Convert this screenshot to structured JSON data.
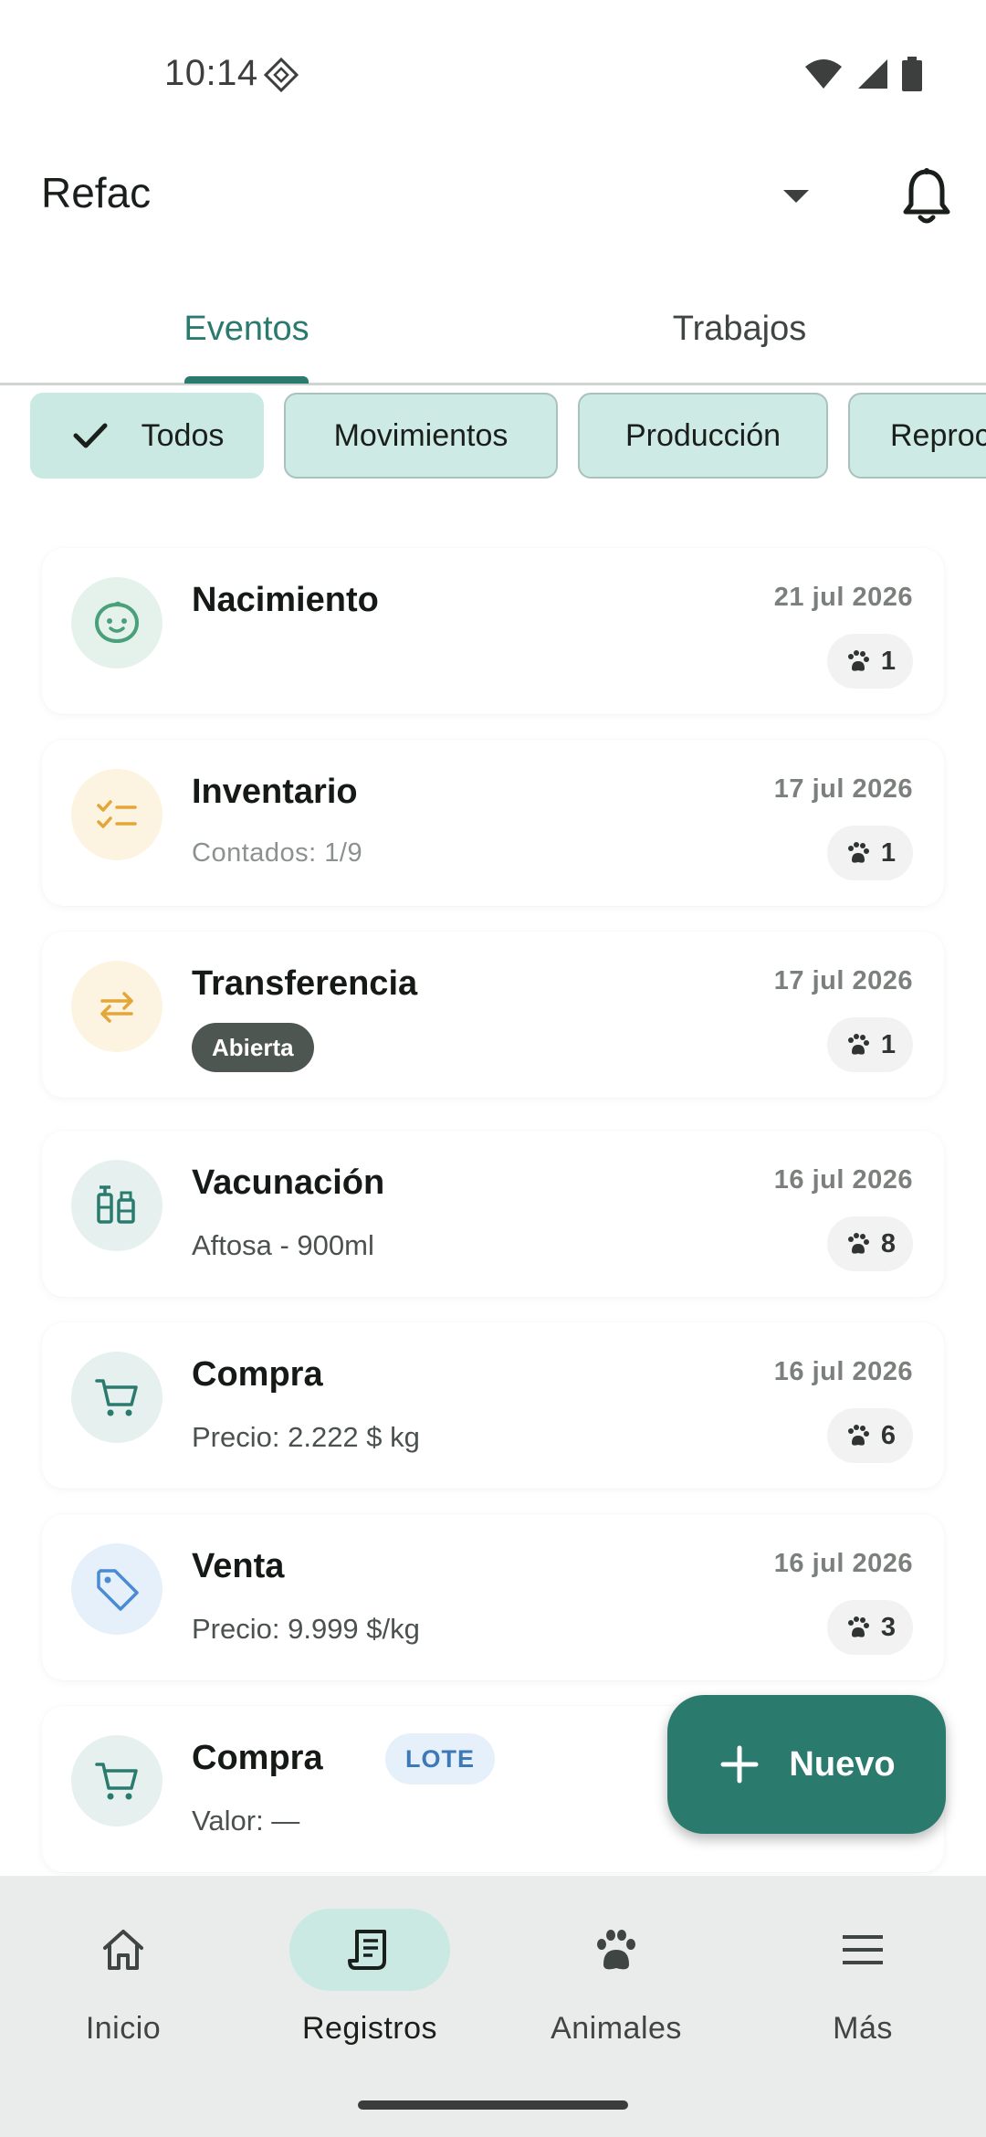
{
  "status_bar": {
    "time": "10:14"
  },
  "app_bar": {
    "title": "Refac"
  },
  "tabs": [
    {
      "label": "Eventos",
      "selected": true
    },
    {
      "label": "Trabajos",
      "selected": false
    }
  ],
  "filters": [
    {
      "label": "Todos",
      "selected": true
    },
    {
      "label": "Movimientos",
      "selected": false
    },
    {
      "label": "Producción",
      "selected": false
    },
    {
      "label": "Reproc",
      "selected": false
    }
  ],
  "events": [
    {
      "icon": "baby-face-icon",
      "title": "Nacimiento",
      "date": "21 jul 2026",
      "count": "1"
    },
    {
      "icon": "checklist-icon",
      "title": "Inventario",
      "subtitle": "Contados: 1/9",
      "date": "17 jul 2026",
      "count": "1"
    },
    {
      "icon": "transfer-arrows-icon",
      "title": "Transferencia",
      "status": "Abierta",
      "date": "17 jul 2026",
      "count": "1"
    },
    {
      "icon": "vaccine-vials-icon",
      "title": "Vacunación",
      "subtitle": "Aftosa - 900ml",
      "date": "16 jul 2026",
      "count": "8"
    },
    {
      "icon": "shopping-cart-icon",
      "title": "Compra",
      "subtitle": "Precio: 2.222 $ kg",
      "date": "16 jul 2026",
      "count": "6"
    },
    {
      "icon": "price-tag-icon",
      "title": "Venta",
      "subtitle": "Precio: 9.999 $/kg",
      "date": "16 jul 2026",
      "count": "3"
    },
    {
      "icon": "shopping-cart-icon",
      "title": "Compra",
      "badge": "LOTE",
      "subtitle": "Valor: —"
    }
  ],
  "fab": {
    "label": "Nuevo"
  },
  "bottom_nav": [
    {
      "label": "Inicio",
      "icon": "home-icon",
      "active": false
    },
    {
      "label": "Registros",
      "icon": "receipt-icon",
      "active": true
    },
    {
      "label": "Animales",
      "icon": "paw-icon",
      "active": false
    },
    {
      "label": "Más",
      "icon": "menu-icon",
      "active": false
    }
  ],
  "colors": {
    "primary": "#2a7a6e",
    "chip_bg": "#cdeae4",
    "nav_bg": "#e9ecea",
    "status_pill": "#4e5651",
    "lote_badge_text": "#3c79b6"
  }
}
